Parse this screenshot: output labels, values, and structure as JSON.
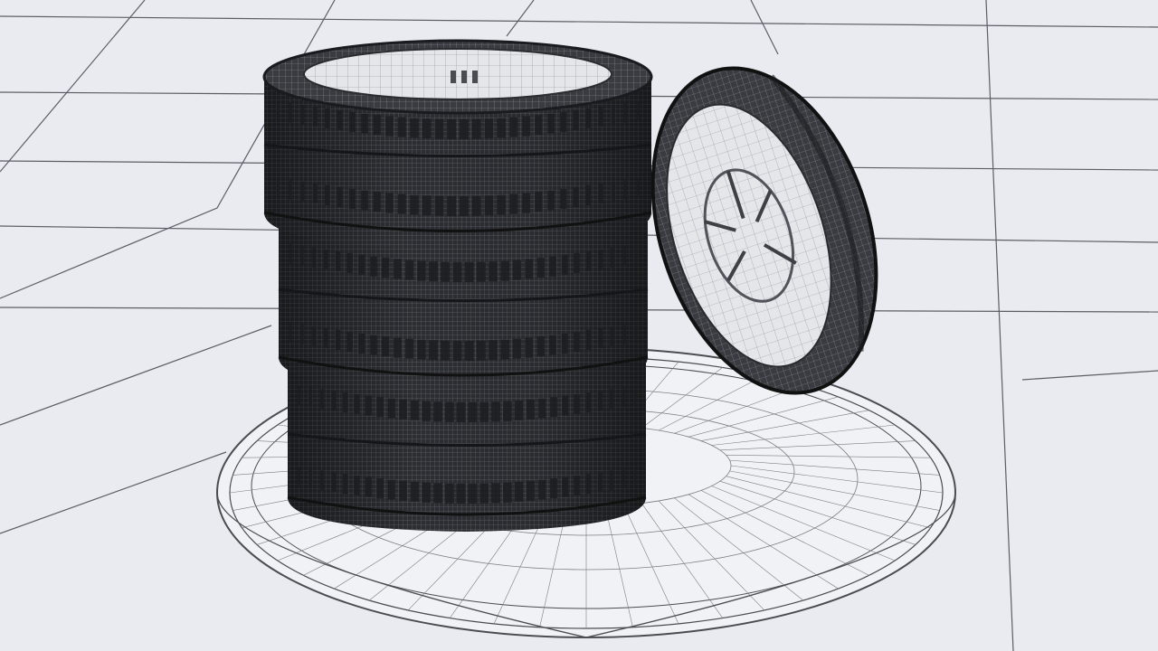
{
  "scene": {
    "subject": "wireframe-render",
    "objects": [
      "stacked-tire-1",
      "stacked-tire-2",
      "stacked-tire-3",
      "leaning-tire-with-rim",
      "display-platform",
      "ground-grid"
    ]
  },
  "colors": {
    "background": "#e9ebf0",
    "grid_line": "#5b5e66",
    "rubber_dark": "#2c2d31",
    "rubber_mid": "#45474d",
    "wire": "#9fa3ab",
    "platform_fill": "#f1f2f5",
    "platform_wire": "#4a4c52",
    "rim_fill": "#d8dade"
  }
}
